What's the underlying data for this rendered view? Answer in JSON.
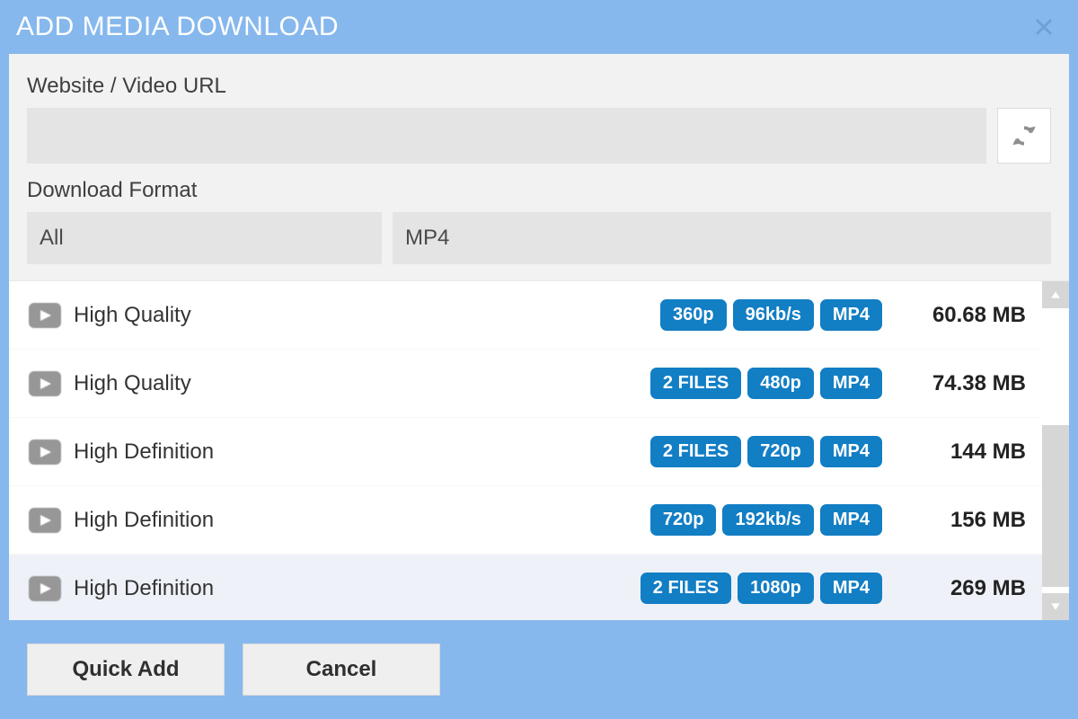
{
  "title": "ADD MEDIA DOWNLOAD",
  "url_label": "Website / Video URL",
  "url_value": "",
  "format_label": "Download Format",
  "format_left": "All",
  "format_right": "MP4",
  "buttons": {
    "quick_add": "Quick Add",
    "cancel": "Cancel"
  },
  "items": [
    {
      "title": "High Quality",
      "chips": [
        "360p",
        "96kb/s",
        "MP4"
      ],
      "size": "60.68 MB",
      "selected": false
    },
    {
      "title": "High Quality",
      "chips": [
        "2 FILES",
        "480p",
        "MP4"
      ],
      "size": "74.38 MB",
      "selected": false
    },
    {
      "title": "High Definition",
      "chips": [
        "2 FILES",
        "720p",
        "MP4"
      ],
      "size": "144 MB",
      "selected": false
    },
    {
      "title": "High Definition",
      "chips": [
        "720p",
        "192kb/s",
        "MP4"
      ],
      "size": "156 MB",
      "selected": false
    },
    {
      "title": "High Definition",
      "chips": [
        "2 FILES",
        "1080p",
        "MP4"
      ],
      "size": "269 MB",
      "selected": true
    }
  ]
}
